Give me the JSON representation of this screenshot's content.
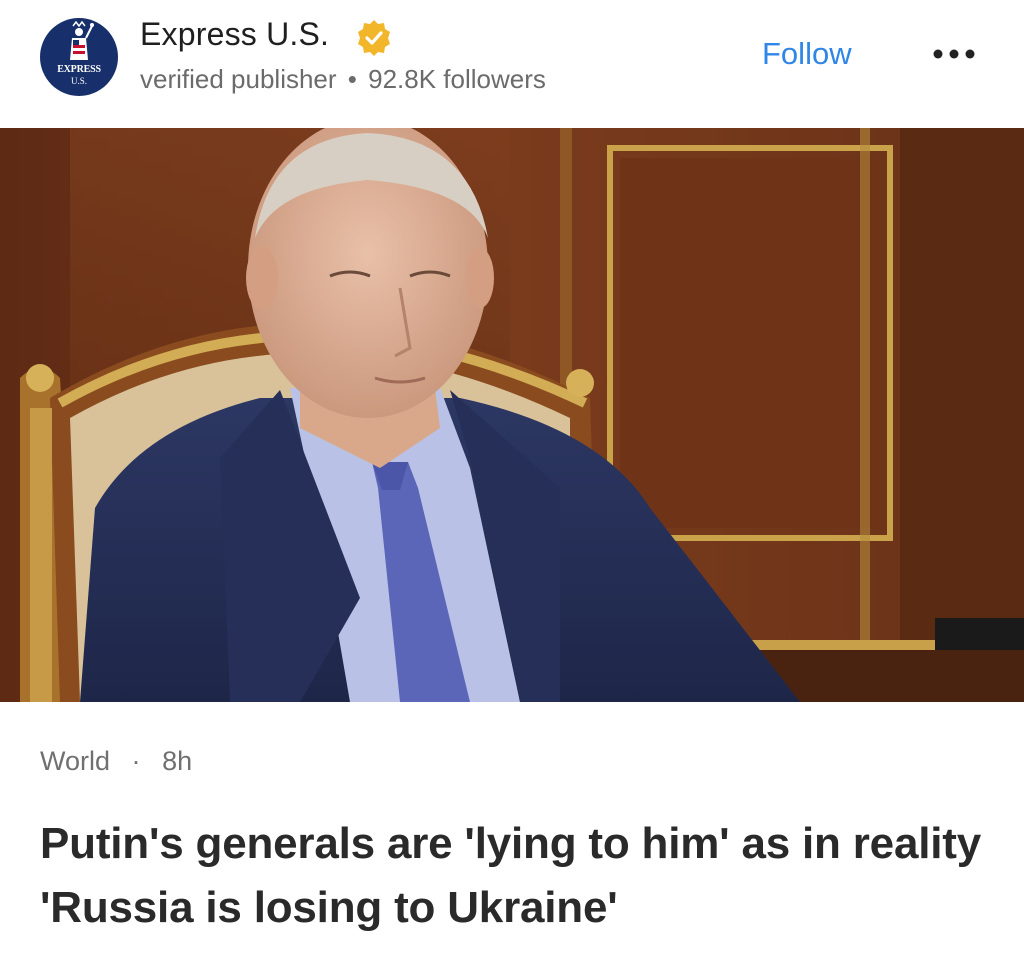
{
  "publisher": {
    "name": "Express U.S.",
    "logo_text_top": "EXPRESS",
    "logo_text_bottom": "U.S.",
    "label": "verified publisher",
    "separator": "•",
    "followers": "92.8K followers",
    "follow_label": "Follow",
    "verified_icon": "verified-badge-icon",
    "more_icon": "more-horizontal-icon"
  },
  "article": {
    "category": "World",
    "separator": "·",
    "age": "8h",
    "headline": "Putin's generals are 'lying to him' as in reality 'Russia is losing to Ukraine'"
  },
  "colors": {
    "accent": "#2f86e6",
    "badge": "#f2b62a",
    "logo_bg": "#17306b"
  }
}
